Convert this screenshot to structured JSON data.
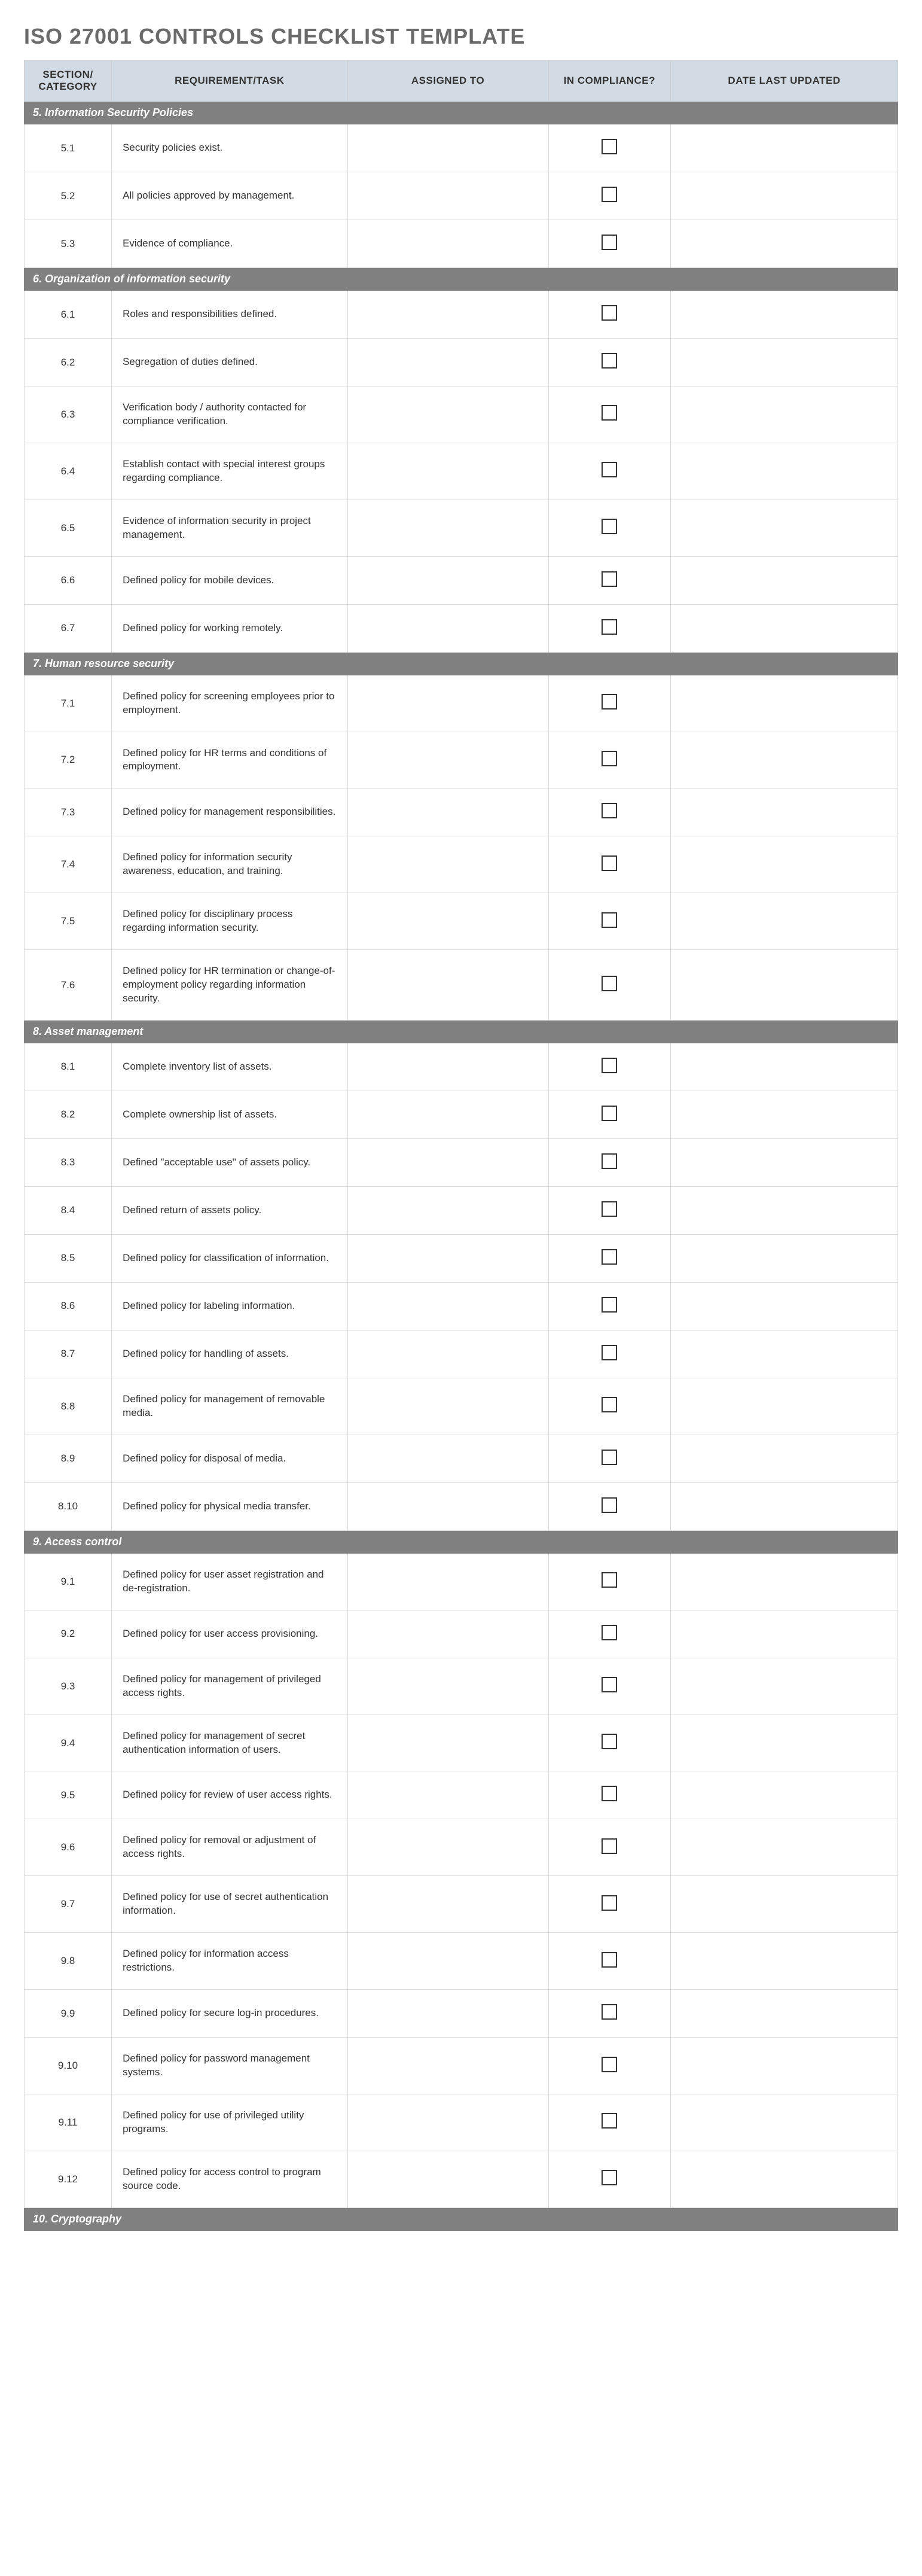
{
  "title": "ISO 27001 CONTROLS CHECKLIST TEMPLATE",
  "headers": {
    "section": "SECTION/ CATEGORY",
    "task": "REQUIREMENT/TASK",
    "assigned": "ASSIGNED TO",
    "compliance": "IN COMPLIANCE?",
    "date": "DATE LAST UPDATED"
  },
  "sections": [
    {
      "title": "5. Information Security Policies",
      "rows": [
        {
          "num": "5.1",
          "task": "Security policies exist.",
          "assigned": "",
          "compliance": false,
          "date": ""
        },
        {
          "num": "5.2",
          "task": "All policies approved by management.",
          "assigned": "",
          "compliance": false,
          "date": ""
        },
        {
          "num": "5.3",
          "task": "Evidence of compliance.",
          "assigned": "",
          "compliance": false,
          "date": ""
        }
      ]
    },
    {
      "title": "6. Organization of information security",
      "rows": [
        {
          "num": "6.1",
          "task": "Roles and responsibilities defined.",
          "assigned": "",
          "compliance": false,
          "date": ""
        },
        {
          "num": "6.2",
          "task": "Segregation of duties defined.",
          "assigned": "",
          "compliance": false,
          "date": ""
        },
        {
          "num": "6.3",
          "task": "Verification body / authority contacted for compliance verification.",
          "assigned": "",
          "compliance": false,
          "date": ""
        },
        {
          "num": "6.4",
          "task": "Establish contact with special interest groups regarding compliance.",
          "assigned": "",
          "compliance": false,
          "date": ""
        },
        {
          "num": "6.5",
          "task": "Evidence of information security in project management.",
          "assigned": "",
          "compliance": false,
          "date": ""
        },
        {
          "num": "6.6",
          "task": "Defined policy for mobile devices.",
          "assigned": "",
          "compliance": false,
          "date": ""
        },
        {
          "num": "6.7",
          "task": "Defined policy for working remotely.",
          "assigned": "",
          "compliance": false,
          "date": ""
        }
      ]
    },
    {
      "title": "7. Human resource security",
      "rows": [
        {
          "num": "7.1",
          "task": "Defined policy for screening employees prior to employment.",
          "assigned": "",
          "compliance": false,
          "date": ""
        },
        {
          "num": "7.2",
          "task": "Defined policy for HR terms and conditions of employment.",
          "assigned": "",
          "compliance": false,
          "date": ""
        },
        {
          "num": "7.3",
          "task": "Defined policy for management responsibilities.",
          "assigned": "",
          "compliance": false,
          "date": ""
        },
        {
          "num": "7.4",
          "task": "Defined policy for information security awareness, education, and training.",
          "assigned": "",
          "compliance": false,
          "date": ""
        },
        {
          "num": "7.5",
          "task": "Defined policy for disciplinary process regarding information security.",
          "assigned": "",
          "compliance": false,
          "date": ""
        },
        {
          "num": "7.6",
          "task": "Defined policy for HR termination or change-of-employment policy regarding information security.",
          "assigned": "",
          "compliance": false,
          "date": ""
        }
      ]
    },
    {
      "title": "8. Asset management",
      "rows": [
        {
          "num": "8.1",
          "task": "Complete inventory list of assets.",
          "assigned": "",
          "compliance": false,
          "date": ""
        },
        {
          "num": "8.2",
          "task": "Complete ownership list of assets.",
          "assigned": "",
          "compliance": false,
          "date": ""
        },
        {
          "num": "8.3",
          "task": "Defined \"acceptable use\" of assets policy.",
          "assigned": "",
          "compliance": false,
          "date": ""
        },
        {
          "num": "8.4",
          "task": "Defined return of assets policy.",
          "assigned": "",
          "compliance": false,
          "date": ""
        },
        {
          "num": "8.5",
          "task": "Defined policy for classification of information.",
          "assigned": "",
          "compliance": false,
          "date": ""
        },
        {
          "num": "8.6",
          "task": "Defined policy for labeling information.",
          "assigned": "",
          "compliance": false,
          "date": ""
        },
        {
          "num": "8.7",
          "task": "Defined policy for handling of assets.",
          "assigned": "",
          "compliance": false,
          "date": ""
        },
        {
          "num": "8.8",
          "task": "Defined policy for management of removable media.",
          "assigned": "",
          "compliance": false,
          "date": ""
        },
        {
          "num": "8.9",
          "task": "Defined policy for disposal of media.",
          "assigned": "",
          "compliance": false,
          "date": ""
        },
        {
          "num": "8.10",
          "task": "Defined policy for physical media transfer.",
          "assigned": "",
          "compliance": false,
          "date": ""
        }
      ]
    },
    {
      "title": "9. Access control",
      "rows": [
        {
          "num": "9.1",
          "task": "Defined policy for user asset registration and de-registration.",
          "assigned": "",
          "compliance": false,
          "date": ""
        },
        {
          "num": "9.2",
          "task": "Defined policy for user access provisioning.",
          "assigned": "",
          "compliance": false,
          "date": ""
        },
        {
          "num": "9.3",
          "task": "Defined policy for management of privileged access rights.",
          "assigned": "",
          "compliance": false,
          "date": ""
        },
        {
          "num": "9.4",
          "task": "Defined policy for management of secret authentication information of users.",
          "assigned": "",
          "compliance": false,
          "date": ""
        },
        {
          "num": "9.5",
          "task": "Defined policy for review of user access rights.",
          "assigned": "",
          "compliance": false,
          "date": ""
        },
        {
          "num": "9.6",
          "task": "Defined policy for removal or adjustment of access rights.",
          "assigned": "",
          "compliance": false,
          "date": ""
        },
        {
          "num": "9.7",
          "task": "Defined policy for use of secret authentication information.",
          "assigned": "",
          "compliance": false,
          "date": ""
        },
        {
          "num": "9.8",
          "task": "Defined policy for information access restrictions.",
          "assigned": "",
          "compliance": false,
          "date": ""
        },
        {
          "num": "9.9",
          "task": "Defined policy for secure log-in procedures.",
          "assigned": "",
          "compliance": false,
          "date": ""
        },
        {
          "num": "9.10",
          "task": "Defined policy for password management systems.",
          "assigned": "",
          "compliance": false,
          "date": ""
        },
        {
          "num": "9.11",
          "task": "Defined policy for use of privileged utility programs.",
          "assigned": "",
          "compliance": false,
          "date": ""
        },
        {
          "num": "9.12",
          "task": "Defined policy for access control to program source code.",
          "assigned": "",
          "compliance": false,
          "date": ""
        }
      ]
    },
    {
      "title": "10. Cryptography",
      "rows": []
    }
  ]
}
